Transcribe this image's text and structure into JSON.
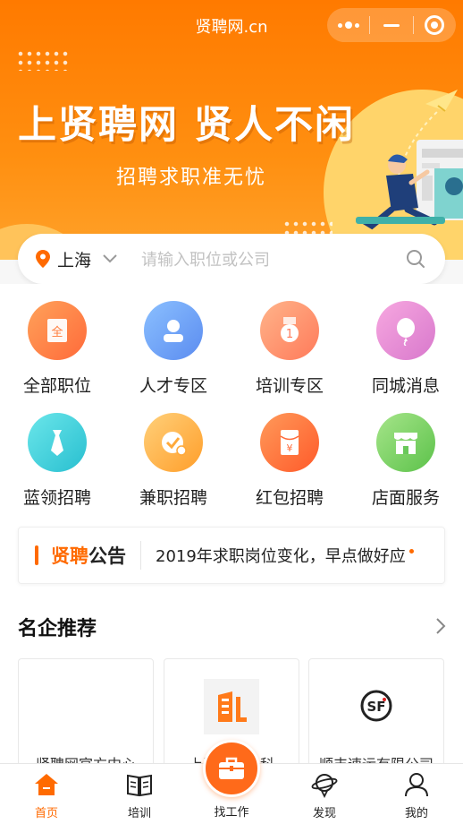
{
  "app": {
    "title": "贤聘网.cn"
  },
  "banner": {
    "slogan": "上贤聘网  贤人不闲",
    "subtitle": "招聘求职准无忧"
  },
  "search": {
    "city": "上海",
    "placeholder": "请输入职位或公司"
  },
  "categories": [
    {
      "label": "全部职位",
      "icon": "all-jobs-icon",
      "color": "#ff7b3a",
      "glyph": "全"
    },
    {
      "label": "人才专区",
      "icon": "talent-icon",
      "color": "#5b9cf0"
    },
    {
      "label": "培训专区",
      "icon": "training-medal-icon",
      "color": "#ff8a5c",
      "glyph": "1"
    },
    {
      "label": "同城消息",
      "icon": "balloon-icon",
      "color": "#e88ad6"
    },
    {
      "label": "蓝领招聘",
      "icon": "tie-icon",
      "color": "#3fd0d8"
    },
    {
      "label": "兼职招聘",
      "icon": "clock-check-icon",
      "color": "#ffb13a"
    },
    {
      "label": "红包招聘",
      "icon": "red-envelope-icon",
      "color": "#ff6a3a",
      "glyph": "¥"
    },
    {
      "label": "店面服务",
      "icon": "store-icon",
      "color": "#7ad06a"
    }
  ],
  "notice": {
    "brand_orange": "贤聘",
    "brand_dark": "公告",
    "text": "2019年求职岗位变化，早点做好应"
  },
  "section": {
    "title": "名企推荐"
  },
  "companies": [
    {
      "name": "贤聘网官方中心"
    },
    {
      "name": "上海鲸……科"
    },
    {
      "name": "顺丰速运有限公司",
      "logo_text": "SF"
    }
  ],
  "tabs": [
    {
      "label": "首页",
      "icon": "home-icon"
    },
    {
      "label": "培训",
      "icon": "book-icon"
    },
    {
      "label": "找工作",
      "icon": "briefcase-icon"
    },
    {
      "label": "发现",
      "icon": "planet-icon"
    },
    {
      "label": "我的",
      "icon": "user-icon"
    }
  ],
  "colors": {
    "accent": "#ff6a00",
    "banner": "#ff8a10"
  }
}
